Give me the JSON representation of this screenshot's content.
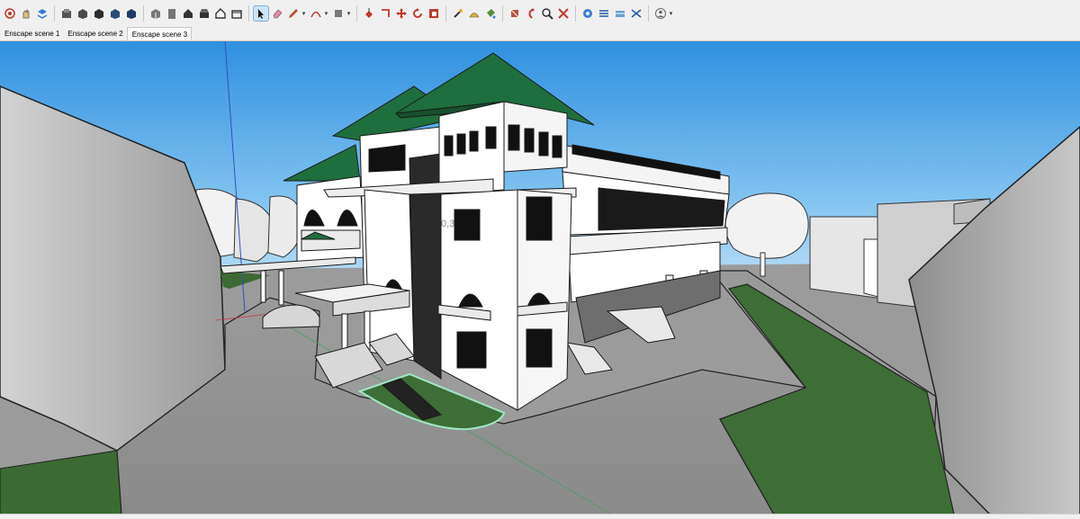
{
  "toolbar": {
    "buttons": [
      {
        "name": "orbit-icon",
        "group": 1
      },
      {
        "name": "pan-icon",
        "group": 1
      },
      {
        "name": "layers-icon",
        "group": 1
      },
      {
        "name": "component-icon",
        "group": 2
      },
      {
        "name": "box-shaded-icon",
        "group": 2
      },
      {
        "name": "box-textured-icon",
        "group": 2
      },
      {
        "name": "box-monochrome-icon",
        "group": 2
      },
      {
        "name": "box-xray-icon",
        "group": 2
      },
      {
        "name": "iso-view-icon",
        "group": 3
      },
      {
        "name": "top-view-icon",
        "group": 3
      },
      {
        "name": "front-view-icon",
        "group": 3
      },
      {
        "name": "right-view-icon",
        "group": 3
      },
      {
        "name": "back-view-icon",
        "group": 3
      },
      {
        "name": "left-view-icon",
        "group": 3
      },
      {
        "name": "select-arrow-icon",
        "group": 4,
        "active": true
      },
      {
        "name": "eraser-icon",
        "group": 4
      },
      {
        "name": "pencil-icon",
        "group": 4,
        "dropdown": true
      },
      {
        "name": "arc-icon",
        "group": 4,
        "dropdown": true
      },
      {
        "name": "rectangle-icon",
        "group": 4,
        "dropdown": true
      },
      {
        "name": "push-pull-icon",
        "group": 5
      },
      {
        "name": "offset-icon",
        "group": 5
      },
      {
        "name": "move-icon",
        "group": 5
      },
      {
        "name": "rotate-icon",
        "group": 5
      },
      {
        "name": "scale-icon",
        "group": 5
      },
      {
        "name": "tape-measure-icon",
        "group": 6
      },
      {
        "name": "protractor-icon",
        "group": 6
      },
      {
        "name": "paint-bucket-icon",
        "group": 6
      },
      {
        "name": "section-plane-icon",
        "group": 7
      },
      {
        "name": "walk-icon",
        "group": 7
      },
      {
        "name": "zoom-icon",
        "group": 7
      },
      {
        "name": "zoom-extents-icon",
        "group": 7
      },
      {
        "name": "enscape-start-icon",
        "group": 8
      },
      {
        "name": "enscape-sync-icon",
        "group": 8
      },
      {
        "name": "enscape-views-icon",
        "group": 8
      },
      {
        "name": "enscape-settings-icon",
        "group": 8
      },
      {
        "name": "user-account-icon",
        "group": 9,
        "dropdown": true
      }
    ]
  },
  "scenes": {
    "tabs": [
      {
        "label": "Enscape scene 1",
        "active": false
      },
      {
        "label": "Enscape scene 2",
        "active": false
      },
      {
        "label": "Enscape scene 3",
        "active": true
      }
    ]
  },
  "viewport": {
    "measurement_text": "0,3",
    "colors": {
      "sky_top": "#2f90e0",
      "sky_bottom": "#c4e2f7",
      "grass": "#3c6e34",
      "road": "#8e8e8e",
      "roof": "#1f6e3e",
      "wall": "#ffffff",
      "window": "#111111",
      "selection_highlight": "#9ee6c4"
    }
  }
}
